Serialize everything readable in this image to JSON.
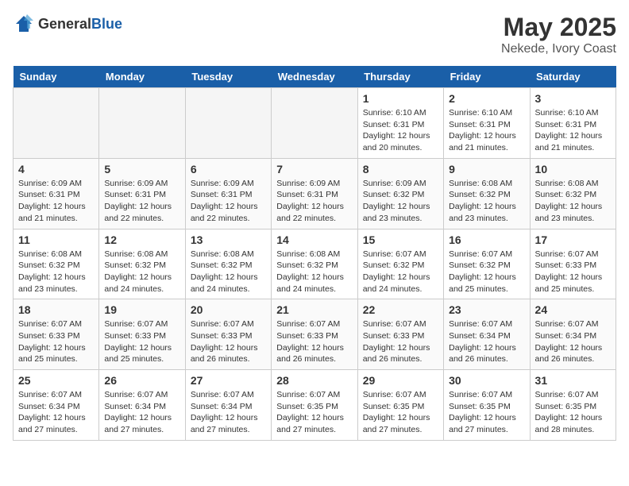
{
  "logo": {
    "general": "General",
    "blue": "Blue"
  },
  "title": {
    "month": "May 2025",
    "location": "Nekede, Ivory Coast"
  },
  "headers": [
    "Sunday",
    "Monday",
    "Tuesday",
    "Wednesday",
    "Thursday",
    "Friday",
    "Saturday"
  ],
  "weeks": [
    [
      {
        "day": "",
        "info": ""
      },
      {
        "day": "",
        "info": ""
      },
      {
        "day": "",
        "info": ""
      },
      {
        "day": "",
        "info": ""
      },
      {
        "day": "1",
        "info": "Sunrise: 6:10 AM\nSunset: 6:31 PM\nDaylight: 12 hours\nand 20 minutes."
      },
      {
        "day": "2",
        "info": "Sunrise: 6:10 AM\nSunset: 6:31 PM\nDaylight: 12 hours\nand 21 minutes."
      },
      {
        "day": "3",
        "info": "Sunrise: 6:10 AM\nSunset: 6:31 PM\nDaylight: 12 hours\nand 21 minutes."
      }
    ],
    [
      {
        "day": "4",
        "info": "Sunrise: 6:09 AM\nSunset: 6:31 PM\nDaylight: 12 hours\nand 21 minutes."
      },
      {
        "day": "5",
        "info": "Sunrise: 6:09 AM\nSunset: 6:31 PM\nDaylight: 12 hours\nand 22 minutes."
      },
      {
        "day": "6",
        "info": "Sunrise: 6:09 AM\nSunset: 6:31 PM\nDaylight: 12 hours\nand 22 minutes."
      },
      {
        "day": "7",
        "info": "Sunrise: 6:09 AM\nSunset: 6:31 PM\nDaylight: 12 hours\nand 22 minutes."
      },
      {
        "day": "8",
        "info": "Sunrise: 6:09 AM\nSunset: 6:32 PM\nDaylight: 12 hours\nand 23 minutes."
      },
      {
        "day": "9",
        "info": "Sunrise: 6:08 AM\nSunset: 6:32 PM\nDaylight: 12 hours\nand 23 minutes."
      },
      {
        "day": "10",
        "info": "Sunrise: 6:08 AM\nSunset: 6:32 PM\nDaylight: 12 hours\nand 23 minutes."
      }
    ],
    [
      {
        "day": "11",
        "info": "Sunrise: 6:08 AM\nSunset: 6:32 PM\nDaylight: 12 hours\nand 23 minutes."
      },
      {
        "day": "12",
        "info": "Sunrise: 6:08 AM\nSunset: 6:32 PM\nDaylight: 12 hours\nand 24 minutes."
      },
      {
        "day": "13",
        "info": "Sunrise: 6:08 AM\nSunset: 6:32 PM\nDaylight: 12 hours\nand 24 minutes."
      },
      {
        "day": "14",
        "info": "Sunrise: 6:08 AM\nSunset: 6:32 PM\nDaylight: 12 hours\nand 24 minutes."
      },
      {
        "day": "15",
        "info": "Sunrise: 6:07 AM\nSunset: 6:32 PM\nDaylight: 12 hours\nand 24 minutes."
      },
      {
        "day": "16",
        "info": "Sunrise: 6:07 AM\nSunset: 6:32 PM\nDaylight: 12 hours\nand 25 minutes."
      },
      {
        "day": "17",
        "info": "Sunrise: 6:07 AM\nSunset: 6:33 PM\nDaylight: 12 hours\nand 25 minutes."
      }
    ],
    [
      {
        "day": "18",
        "info": "Sunrise: 6:07 AM\nSunset: 6:33 PM\nDaylight: 12 hours\nand 25 minutes."
      },
      {
        "day": "19",
        "info": "Sunrise: 6:07 AM\nSunset: 6:33 PM\nDaylight: 12 hours\nand 25 minutes."
      },
      {
        "day": "20",
        "info": "Sunrise: 6:07 AM\nSunset: 6:33 PM\nDaylight: 12 hours\nand 26 minutes."
      },
      {
        "day": "21",
        "info": "Sunrise: 6:07 AM\nSunset: 6:33 PM\nDaylight: 12 hours\nand 26 minutes."
      },
      {
        "day": "22",
        "info": "Sunrise: 6:07 AM\nSunset: 6:33 PM\nDaylight: 12 hours\nand 26 minutes."
      },
      {
        "day": "23",
        "info": "Sunrise: 6:07 AM\nSunset: 6:34 PM\nDaylight: 12 hours\nand 26 minutes."
      },
      {
        "day": "24",
        "info": "Sunrise: 6:07 AM\nSunset: 6:34 PM\nDaylight: 12 hours\nand 26 minutes."
      }
    ],
    [
      {
        "day": "25",
        "info": "Sunrise: 6:07 AM\nSunset: 6:34 PM\nDaylight: 12 hours\nand 27 minutes."
      },
      {
        "day": "26",
        "info": "Sunrise: 6:07 AM\nSunset: 6:34 PM\nDaylight: 12 hours\nand 27 minutes."
      },
      {
        "day": "27",
        "info": "Sunrise: 6:07 AM\nSunset: 6:34 PM\nDaylight: 12 hours\nand 27 minutes."
      },
      {
        "day": "28",
        "info": "Sunrise: 6:07 AM\nSunset: 6:35 PM\nDaylight: 12 hours\nand 27 minutes."
      },
      {
        "day": "29",
        "info": "Sunrise: 6:07 AM\nSunset: 6:35 PM\nDaylight: 12 hours\nand 27 minutes."
      },
      {
        "day": "30",
        "info": "Sunrise: 6:07 AM\nSunset: 6:35 PM\nDaylight: 12 hours\nand 27 minutes."
      },
      {
        "day": "31",
        "info": "Sunrise: 6:07 AM\nSunset: 6:35 PM\nDaylight: 12 hours\nand 28 minutes."
      }
    ]
  ]
}
